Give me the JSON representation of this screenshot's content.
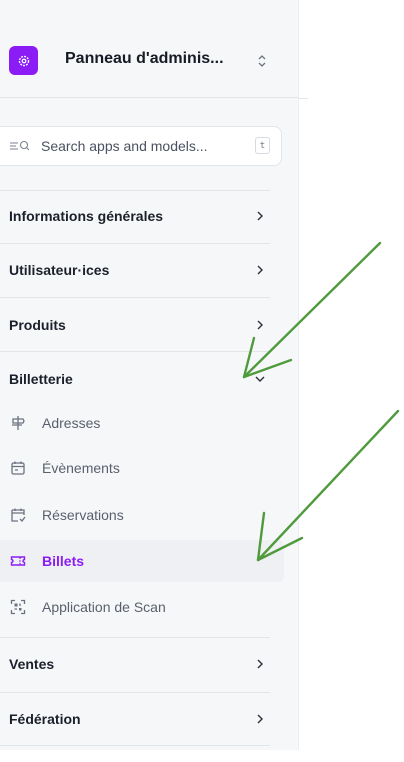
{
  "app": {
    "title": "Panneau d'adminis...",
    "logo_icon": "gear-icon",
    "switch_icon": "chevron-up-down-icon",
    "brand_color": "#8b1cf5"
  },
  "search": {
    "placeholder": "Search apps and models...",
    "shortcut": "t",
    "icon": "search-icon"
  },
  "nav": {
    "sections": [
      {
        "label": "Informations générales",
        "icon": "chevron-right-icon"
      },
      {
        "label": "Utilisateur·ices",
        "icon": "chevron-right-icon"
      },
      {
        "label": "Produits",
        "icon": "chevron-right-icon"
      },
      {
        "label": "Billetterie",
        "icon": "chevron-down-icon",
        "expanded": true
      },
      {
        "label": "Ventes",
        "icon": "chevron-right-icon"
      },
      {
        "label": "Fédération",
        "icon": "chevron-right-icon"
      }
    ],
    "billetterie_items": [
      {
        "label": "Adresses",
        "icon": "signpost-icon"
      },
      {
        "label": "Évènements",
        "icon": "calendar-icon"
      },
      {
        "label": "Réservations",
        "icon": "calendar-check-icon"
      },
      {
        "label": "Billets",
        "icon": "ticket-icon",
        "active": true
      },
      {
        "label": "Application de Scan",
        "icon": "qr-scan-icon"
      }
    ]
  },
  "annotations": {
    "arrow_color": "#4f9a3c",
    "arrows": [
      "arrow-to-billetterie",
      "arrow-to-billets"
    ]
  }
}
